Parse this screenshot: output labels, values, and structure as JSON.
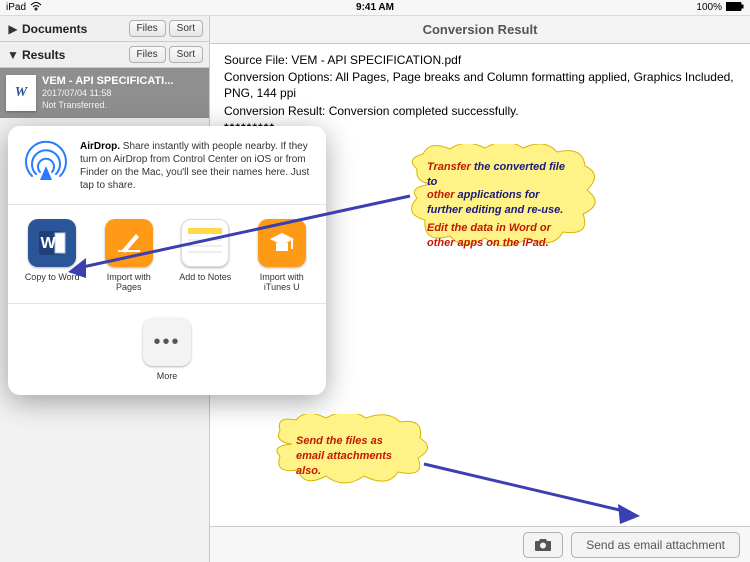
{
  "status": {
    "device": "iPad",
    "time": "9:41 AM",
    "battery": "100%"
  },
  "sidebar": {
    "sections": [
      {
        "chev": "▶",
        "title": "Documents",
        "files_btn": "Files",
        "sort_btn": "Sort"
      },
      {
        "chev": "▼",
        "title": "Results",
        "files_btn": "Files",
        "sort_btn": "Sort"
      }
    ],
    "file": {
      "thumb": "W",
      "name": "VEM - API SPECIFICATI...",
      "date": "2017/07/04 11:58",
      "status": "Not Transferred."
    }
  },
  "right": {
    "header": "Conversion Result",
    "line1": "Source File: VEM - API SPECIFICATION.pdf",
    "line2": "Conversion Options: All Pages, Page breaks and Column formatting applied, Graphics Included, PNG, 144 ppi",
    "line3": "Conversion Result: Conversion completed successfully.",
    "stars": "*********",
    "send_btn": "Send as email attachment"
  },
  "share": {
    "airdrop_bold": "AirDrop.",
    "airdrop_text": " Share instantly with people nearby. If they turn on AirDrop from Control Center on iOS or from Finder on the Mac, you'll see their names here. Just tap to share.",
    "apps": [
      {
        "name": "copy-to-word",
        "label": "Copy to Word"
      },
      {
        "name": "import-pages",
        "label": "Import with Pages"
      },
      {
        "name": "add-to-notes",
        "label": "Add to Notes"
      },
      {
        "name": "import-itunesu",
        "label": "Import with iTunes U"
      }
    ],
    "more": "More"
  },
  "callouts": {
    "c1_l1_a": "Transfer",
    "c1_l1_b": " the converted file to ",
    "c1_l2_a": "other",
    "c1_l2_b": " applications for further editing and re-use.",
    "c1_l3": "Edit the data in Word or other apps on the iPad.",
    "c2": "Send the files as email attachments also."
  }
}
